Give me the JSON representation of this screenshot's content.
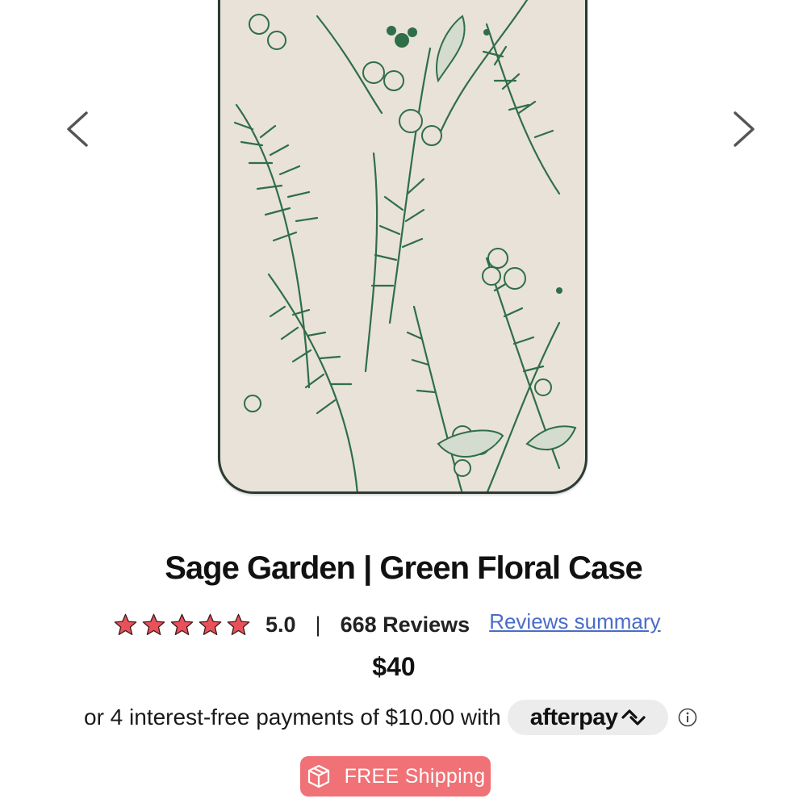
{
  "gallery": {
    "prev_icon": "chevron-left-icon",
    "next_icon": "chevron-right-icon",
    "image_subject": "green botanical floral phone case"
  },
  "product": {
    "title": "Sage Garden | Green Floral Case",
    "rating": {
      "stars": 5,
      "value": "5.0",
      "separator": "|",
      "review_count": "668 Reviews",
      "summary_link": "Reviews summary",
      "star_color": "#e8515a"
    },
    "price": "$40",
    "installments": {
      "text": "or 4 interest-free payments of $10.00 with",
      "provider": "afterpay",
      "info_icon": "info-icon"
    },
    "shipping_badge": {
      "label": "FREE Shipping",
      "icon": "box-icon",
      "color": "#f07276"
    }
  }
}
